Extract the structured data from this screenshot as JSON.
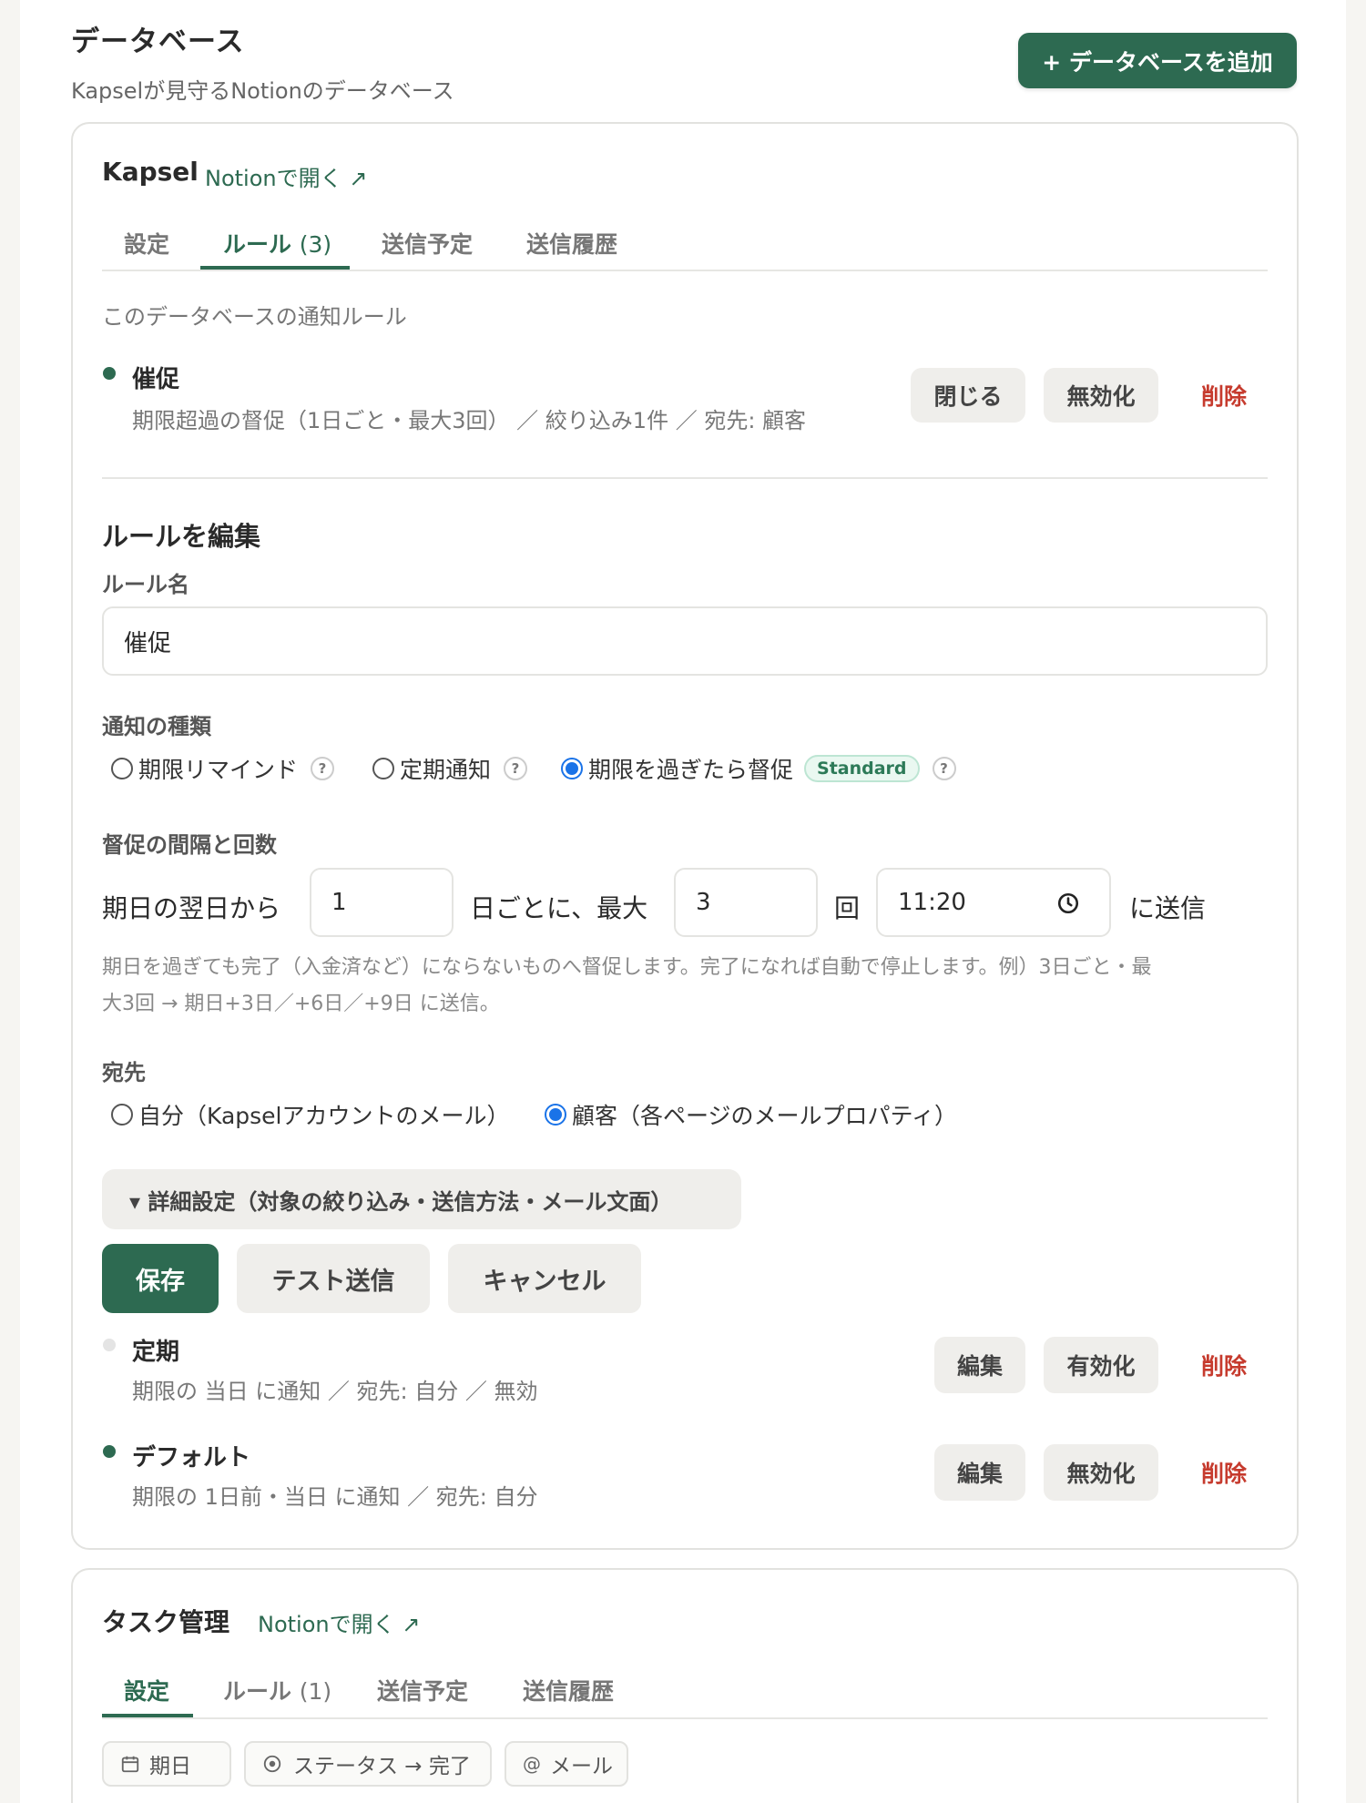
{
  "header": {
    "title": "データベース",
    "subtitle": "Kapselが見守るNotionのデータベース",
    "add_button": "+ データベースを追加"
  },
  "db1": {
    "name": "Kapsel",
    "open_link": "Notionで開く ↗",
    "tabs": [
      {
        "label": "設定",
        "count": ""
      },
      {
        "label": "ルール",
        "count": "(3)"
      },
      {
        "label": "送信予定",
        "count": ""
      },
      {
        "label": "送信履歴",
        "count": ""
      }
    ],
    "rules_caption": "このデータベースの通知ルール",
    "rules": [
      {
        "title": "催促",
        "desc": "期限超過の督促（1日ごと・最大3回） ／ 絞り込み1件 ／ 宛先: 顧客",
        "buttons": [
          "閉じる",
          "無効化"
        ],
        "delete": "削除"
      },
      {
        "title": "定期",
        "desc": "期限の 当日 に通知 ／ 宛先: 自分 ／ 無効",
        "buttons": [
          "編集",
          "有効化"
        ],
        "delete": "削除"
      },
      {
        "title": "デフォルト",
        "desc": "期限の 1日前・当日 に通知 ／ 宛先: 自分",
        "buttons": [
          "編集",
          "無効化"
        ],
        "delete": "削除"
      }
    ],
    "edit": {
      "title": "ルールを編集",
      "name_label": "ルール名",
      "name_value": "催促",
      "type_label": "通知の種類",
      "types": [
        {
          "label": "期限リマインド",
          "help": "?"
        },
        {
          "label": "定期通知",
          "help": "?"
        },
        {
          "label": "期限を過ぎたら督促",
          "badge": "Standard",
          "help": "?"
        }
      ],
      "interval_label": "督促の間隔と回数",
      "interval": {
        "prefix": "期日の翌日から",
        "days": "1",
        "mid": "日ごとに、最大",
        "count": "3",
        "times": "回",
        "time": "11:20",
        "suffix": "に送信"
      },
      "note_line1": "期日を過ぎても完了（入金済など）にならないものへ督促します。完了になれば自動で停止します。例）3日ごと・最",
      "note_line2": "大3回 → 期日+3日／+6日／+9日 に送信。",
      "dest_label": "宛先",
      "dests": [
        {
          "label": "自分（Kapselアカウントのメール）"
        },
        {
          "label": "顧客（各ページのメールプロパティ）"
        }
      ],
      "details": "▾ 詳細設定（対象の絞り込み・送信方法・メール文面）",
      "save": "保存",
      "test": "テスト送信",
      "cancel": "キャンセル"
    }
  },
  "db2": {
    "name": "タスク管理",
    "open_link": "Notionで開く ↗",
    "tabs": [
      {
        "label": "設定",
        "count": ""
      },
      {
        "label": "ルール",
        "count": "(1)"
      },
      {
        "label": "送信予定",
        "count": ""
      },
      {
        "label": "送信履歴",
        "count": ""
      }
    ],
    "chips": [
      "期日",
      "ステータス → 完了",
      "メール"
    ]
  },
  "colors": {
    "accent": "#2d6a51",
    "danger": "#c63b2e",
    "radio": "#1a73e8"
  }
}
